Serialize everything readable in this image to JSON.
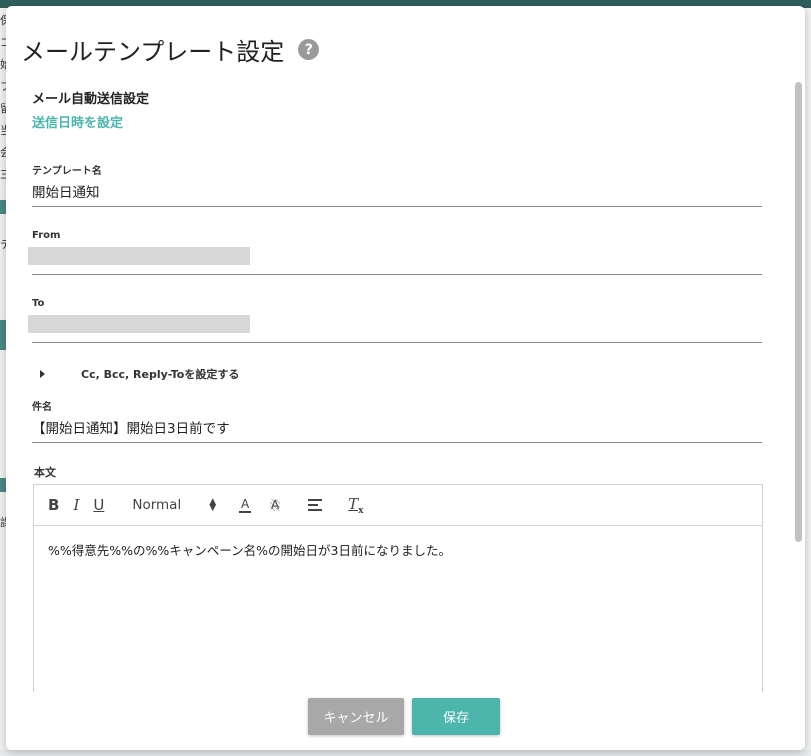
{
  "background": {
    "side_chars": [
      "保",
      "コ",
      "始",
      "フ",
      "留",
      "当",
      "会",
      "三",
      "テ",
      "課"
    ]
  },
  "modal": {
    "title": "メールテンプレート設定",
    "help_icon": "question-circle-icon",
    "help_glyph": "?"
  },
  "auto_send": {
    "section_title": "メール自動送信設定",
    "link_label": "送信日時を設定"
  },
  "fields": {
    "template_name": {
      "label": "テンプレート名",
      "value": "開始日通知"
    },
    "from": {
      "label": "From"
    },
    "to": {
      "label": "To"
    },
    "cc_toggle": "Cc, Bcc, Reply-Toを設定する",
    "subject": {
      "label": "件名",
      "value": "【開始日通知】開始日3日前です"
    },
    "body": {
      "label": "本文"
    }
  },
  "editor": {
    "toolbar": {
      "bold": "B",
      "italic": "I",
      "underline": "U",
      "format_select": "Normal",
      "font_color": "A",
      "background_color": "A",
      "clear_format": "T"
    },
    "content": "%%得意先%%の%%キャンペーン名%の開始日が3日前になりました。"
  },
  "footer": {
    "cancel_label": "キャンセル",
    "save_label": "保存"
  },
  "colors": {
    "accent": "#4db6ac",
    "cancel_button": "#a8a8a8",
    "backdrop": "#2f5f5c"
  }
}
